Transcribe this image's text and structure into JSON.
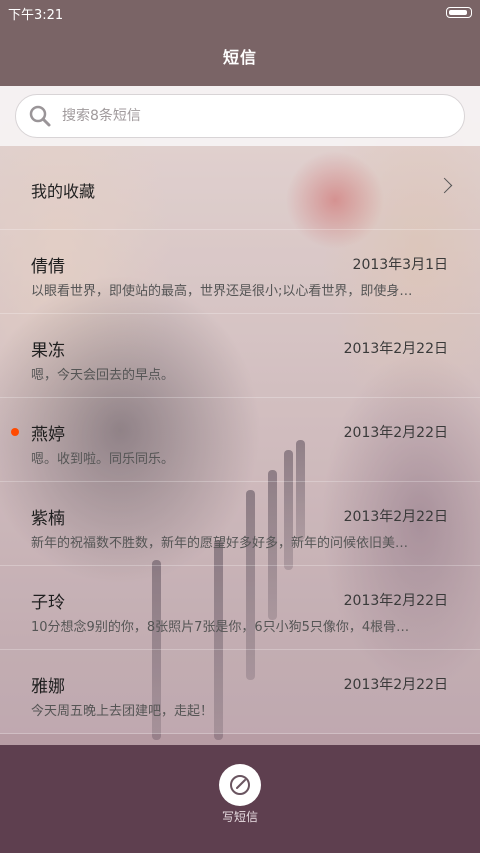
{
  "status_bar": {
    "time": "下午3:21"
  },
  "header": {
    "title": "短信"
  },
  "search": {
    "placeholder": "搜索8条短信"
  },
  "favorites": {
    "label": "我的收藏"
  },
  "conversations": [
    {
      "name": "倩倩",
      "date": "2013年3月1日",
      "preview": "以眼看世界，即使站的最高，世界还是很小;以心看世界，即使身…",
      "unread": false
    },
    {
      "name": "果冻",
      "date": "2013年2月22日",
      "preview": "嗯，今天会回去的早点。",
      "unread": false
    },
    {
      "name": "燕婷",
      "date": "2013年2月22日",
      "preview": "嗯。收到啦。同乐同乐。",
      "unread": true
    },
    {
      "name": "紫楠",
      "date": "2013年2月22日",
      "preview": "新年的祝福数不胜数，新年的愿望好多好多，新年的问候依旧美…",
      "unread": false
    },
    {
      "name": "子玲",
      "date": "2013年2月22日",
      "preview": "10分想念9别的你，8张照片7张是你，6只小狗5只像你，4根骨…",
      "unread": false
    },
    {
      "name": "雅娜",
      "date": "2013年2月22日",
      "preview": "今天周五晚上去团建吧，走起！",
      "unread": false
    }
  ],
  "bottom": {
    "compose_label": "写短信"
  },
  "colors": {
    "bar": "#7a6466",
    "bottom": "#5e3f4f",
    "unread": "#ff4a00"
  },
  "icons": {
    "search": "search-icon",
    "compose": "compose-icon",
    "chevron": "chevron-right-icon",
    "battery": "battery-icon"
  }
}
